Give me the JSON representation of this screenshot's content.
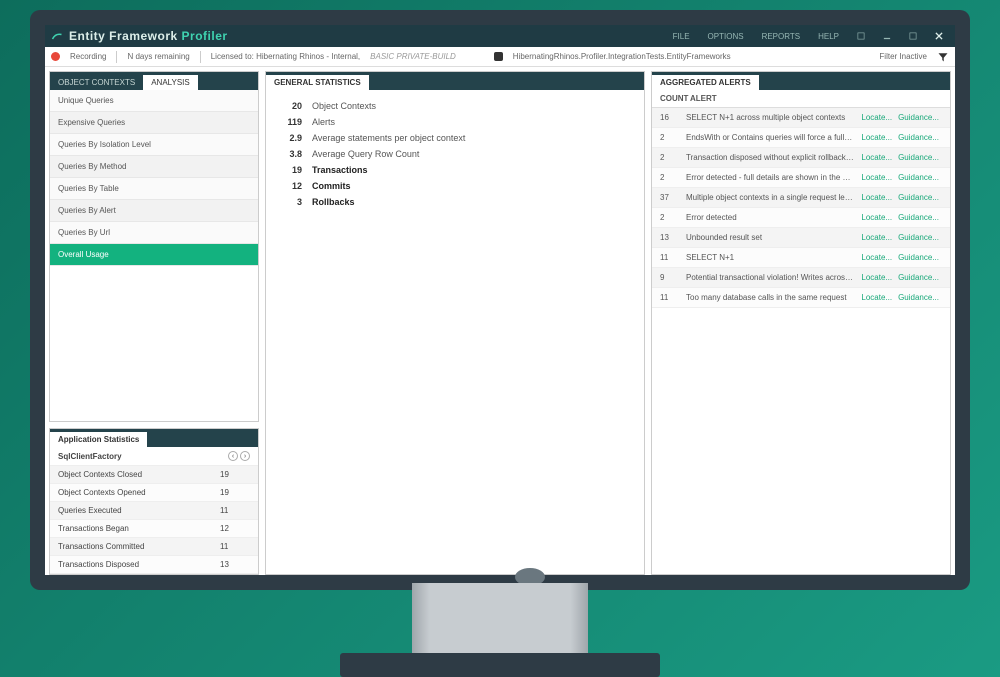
{
  "title": {
    "brand1": "Entity Framework",
    "brand2": "Profiler"
  },
  "menu": {
    "file": "FILE",
    "options": "OPTIONS",
    "reports": "REPORTS",
    "help": "HELP"
  },
  "status": {
    "recording": "Recording",
    "days": "N days remaining",
    "license": "Licensed to: Hibernating Rhinos - Internal,",
    "build": "BASIC PRIVATE-BUILD",
    "connstr": "HibernatingRhinos.Profiler.IntegrationTests.EntityFrameworks",
    "filter": "Filter Inactive"
  },
  "sidebarTabs": {
    "objectContexts": "OBJECT CONTEXTS",
    "analysis": "ANALYSIS"
  },
  "sidebarItems": [
    "Unique Queries",
    "Expensive Queries",
    "Queries By Isolation Level",
    "Queries By Method",
    "Queries By Table",
    "Queries By Alert",
    "Queries By Url",
    "Overall Usage"
  ],
  "appStats": {
    "header": "Application Statistics",
    "groupTitle": "SqlClientFactory",
    "rows": [
      {
        "k": "Object Contexts Closed",
        "v": "19"
      },
      {
        "k": "Object Contexts Opened",
        "v": "19"
      },
      {
        "k": "Queries Executed",
        "v": "11"
      },
      {
        "k": "Transactions Began",
        "v": "12"
      },
      {
        "k": "Transactions Committed",
        "v": "11"
      },
      {
        "k": "Transactions Disposed",
        "v": "13"
      }
    ]
  },
  "generalStats": {
    "header": "GENERAL STATISTICS",
    "rows": [
      {
        "num": "20",
        "label": "Object Contexts",
        "bold": false
      },
      {
        "num": "119",
        "label": "Alerts",
        "bold": false
      },
      {
        "num": "2.9",
        "label": "Average statements per object context",
        "bold": false
      },
      {
        "num": "3.8",
        "label": "Average Query Row Count",
        "bold": false
      },
      {
        "num": "19",
        "label": "Transactions",
        "bold": true
      },
      {
        "num": "12",
        "label": "Commits",
        "bold": true
      },
      {
        "num": "3",
        "label": "Rollbacks",
        "bold": true
      }
    ]
  },
  "aggAlerts": {
    "header": "AGGREGATED ALERTS",
    "colCount": "COUNT",
    "colAlert": "ALERT",
    "linkLocate": "Locate...",
    "linkGuidance": "Guidance...",
    "rows": [
      {
        "cnt": "16",
        "msg": "SELECT N+1 across multiple object contexts"
      },
      {
        "cnt": "2",
        "msg": "EndsWith or Contains queries will force a full table scan"
      },
      {
        "cnt": "2",
        "msg": "Transaction disposed without explicit rollback / commit"
      },
      {
        "cnt": "2",
        "msg": "Error detected - full details are shown in the next statement"
      },
      {
        "cnt": "37",
        "msg": "Multiple object contexts in a single request lead to poor..."
      },
      {
        "cnt": "2",
        "msg": "Error detected"
      },
      {
        "cnt": "13",
        "msg": "Unbounded result set"
      },
      {
        "cnt": "11",
        "msg": "SELECT N+1"
      },
      {
        "cnt": "9",
        "msg": "Potential transactional violation! Writes across multiple..."
      },
      {
        "cnt": "11",
        "msg": "Too many database calls in the same request"
      }
    ]
  }
}
